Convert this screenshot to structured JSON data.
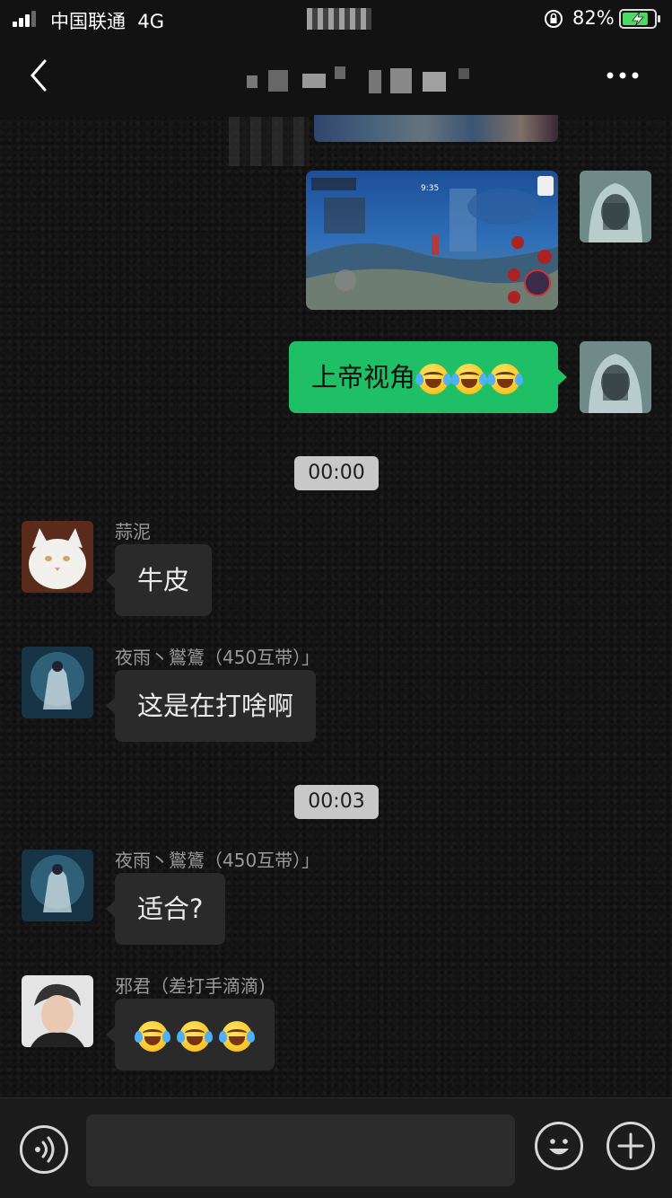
{
  "status_bar": {
    "carrier": "中国联通",
    "network": "4G",
    "battery_percent": "82%",
    "battery_level": 0.82,
    "charging": true
  },
  "nav": {
    "back_icon": "chevron-left-icon",
    "more_icon": "ellipsis-icon"
  },
  "colors": {
    "outgoing_bubble": "#1fbf66",
    "incoming_bubble": "#2a2a2a",
    "timestamp_bg": "#c8c8c8",
    "background": "#141414"
  },
  "game_hud": {
    "timer": "9:35"
  },
  "messages": [
    {
      "direction": "outgoing",
      "type": "text",
      "text": "上帝视角",
      "emoji": [
        "crying-laughing-emoji",
        "crying-laughing-emoji",
        "crying-laughing-emoji"
      ]
    },
    {
      "type": "timestamp",
      "text": "00:00"
    },
    {
      "direction": "incoming",
      "sender": "蒜泥",
      "text": "牛皮"
    },
    {
      "direction": "incoming",
      "sender": "夜雨丶鸑鷟（450互带）」",
      "text": "这是在打啥啊"
    },
    {
      "type": "timestamp",
      "text": "00:03"
    },
    {
      "direction": "incoming",
      "sender": "夜雨丶鸑鷟（450互带）」",
      "text": "适合?"
    },
    {
      "direction": "incoming",
      "sender": "邪君（差打手滴滴)",
      "text": "",
      "emoji": [
        "tears-of-joy-emoji",
        "tears-of-joy-emoji",
        "tears-of-joy-emoji"
      ]
    }
  ],
  "input_bar": {
    "voice_icon": "voice-icon",
    "input_placeholder": "",
    "emoji_icon": "smiley-icon",
    "plus_icon": "plus-icon"
  }
}
